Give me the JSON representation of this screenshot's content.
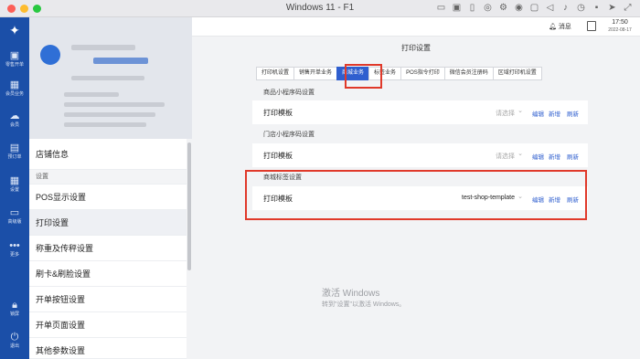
{
  "window": {
    "title": "Windows 11 - F1"
  },
  "rail": [
    {
      "label": "零售开单",
      "icon": "cashier-icon"
    },
    {
      "label": "会员业务",
      "icon": "grid-icon"
    },
    {
      "label": "会员",
      "icon": "cloud-icon"
    },
    {
      "label": "预订单",
      "icon": "bag-icon"
    },
    {
      "label": "设置",
      "icon": "grid-icon"
    },
    {
      "label": "高级版",
      "icon": "briefcase-icon"
    },
    {
      "label": "更多",
      "icon": "more-icon"
    },
    {
      "label": "锁屏",
      "icon": "lock-icon"
    },
    {
      "label": "退出",
      "icon": "power-icon"
    }
  ],
  "menu": {
    "store_info": "店铺信息",
    "section_settings": "设置",
    "items": [
      "POS显示设置",
      "打印设置",
      "称重及传秤设置",
      "刷卡&刷脸设置",
      "开单按钮设置",
      "开单页面设置",
      "其他参数设置"
    ]
  },
  "topbar": {
    "messages": "消息",
    "time": "17:50",
    "date": "2022-08-17"
  },
  "page": {
    "title": "打印设置",
    "tabs": [
      "打印机设置",
      "销售开单业务",
      "商城业务",
      "标签业务",
      "POS指令打印",
      "微信会员注册码",
      "区域打印机设置"
    ],
    "active_tab": "商城业务"
  },
  "sections": [
    {
      "title": "商品小程序码设置",
      "label": "打印模板",
      "value": "请选择",
      "edit": "编辑",
      "add": "新增",
      "refresh": "刷新"
    },
    {
      "title": "门店小程序码设置",
      "label": "打印模板",
      "value": "请选择",
      "edit": "编辑",
      "add": "新增",
      "refresh": "刷新"
    },
    {
      "title": "商城标签设置",
      "label": "打印模板",
      "value": "test-shop-template",
      "edit": "编辑",
      "add": "新增",
      "refresh": "刷新"
    }
  ],
  "watermark": {
    "line1": "激活 Windows",
    "line2": "转到\"设置\"以激活 Windows。"
  },
  "colors": {
    "accent": "#2f5fcf",
    "highlight": "#e0392a",
    "rail": "#1b4fa8"
  }
}
